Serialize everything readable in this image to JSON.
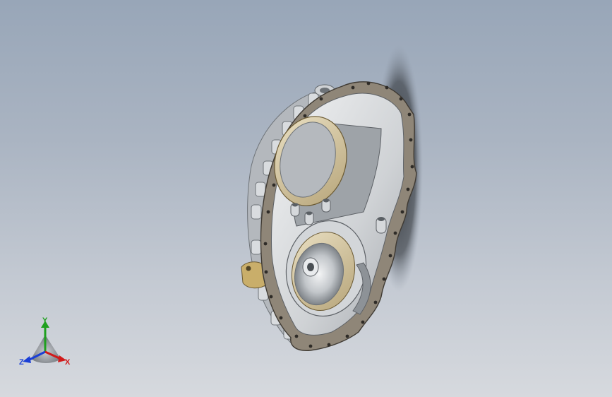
{
  "viewport": {
    "background_top": "#98a6b8",
    "background_bottom": "#d6d9de"
  },
  "model": {
    "part": "gearbox-housing-cover",
    "shadow_color": "#3b3f44",
    "flange_color": "#8f8678",
    "body_color": "#c9ccd0",
    "bearing_color": "#c8b890"
  },
  "triad": {
    "y_label": "Y",
    "z_label": "Z",
    "x_label": "X",
    "y_color": "#1fa01f",
    "z_color": "#1a3fd6",
    "x_color": "#d11a1a"
  }
}
